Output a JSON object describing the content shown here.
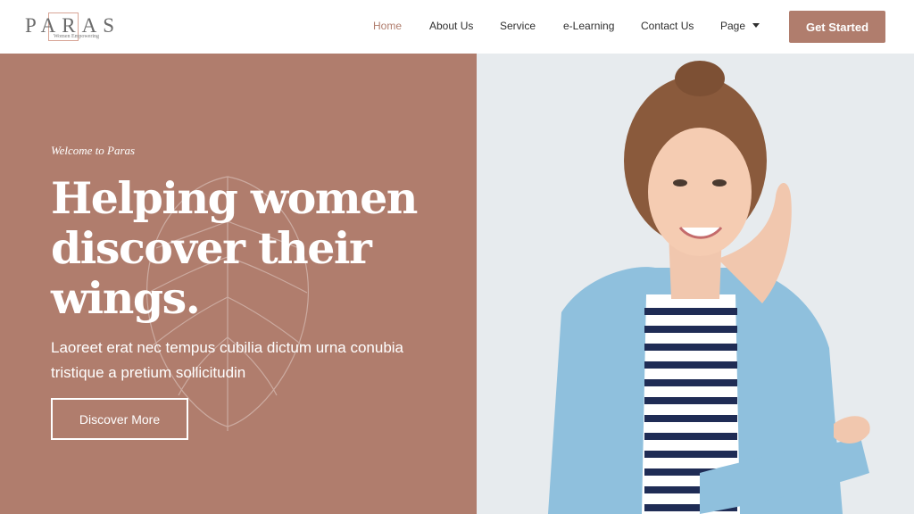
{
  "brand": {
    "name": "PARAS",
    "tagline": "Women Empowering"
  },
  "nav": {
    "items": [
      {
        "label": "Home",
        "active": true
      },
      {
        "label": "About Us"
      },
      {
        "label": "Service"
      },
      {
        "label": "e-Learning"
      },
      {
        "label": "Contact Us"
      },
      {
        "label": "Page",
        "has_dropdown": true,
        "icon": "chevron-down-icon"
      }
    ],
    "cta_label": "Get Started"
  },
  "hero": {
    "eyebrow": "Welcome to Paras",
    "headline": "Helping women discover their wings.",
    "subtext": "Laoreet erat nec tempus cubilia dictum urna conubia tristique a pretium sollicitudin",
    "button_label": "Discover More"
  },
  "colors": {
    "accent": "#b07d6d",
    "active_link": "#b07d6d",
    "text_dark": "#2f2f2f",
    "photo_background": "#e7ebee"
  }
}
